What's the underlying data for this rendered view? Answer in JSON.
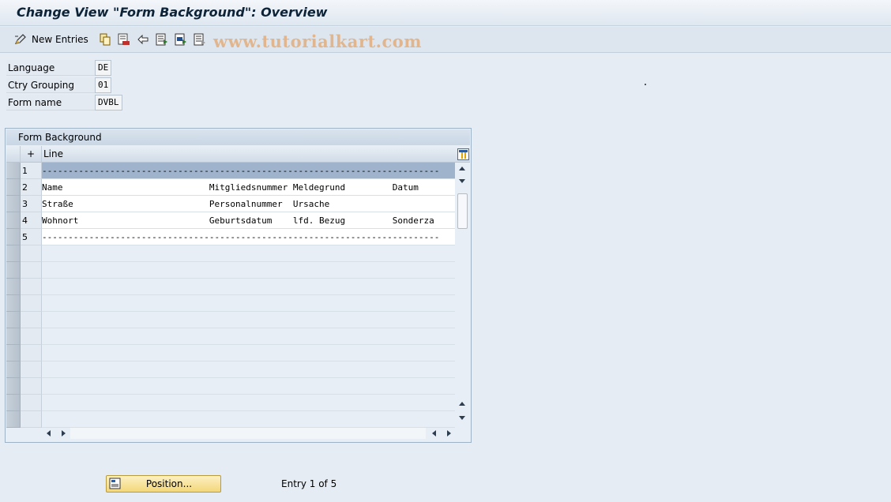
{
  "window": {
    "title": "Change View \"Form Background\": Overview"
  },
  "toolbar": {
    "new_entries_label": "New Entries",
    "watermark": "www.tutorialkart.com",
    "icons": [
      "edit-icon",
      "copy-icon",
      "delete-icon",
      "undo-icon",
      "select-all-icon",
      "select-block-icon",
      "deselect-all-icon"
    ]
  },
  "fields": {
    "language": {
      "label": "Language",
      "value": "DE"
    },
    "ctry_grouping": {
      "label": "Ctry Grouping",
      "value": "01"
    },
    "form_name": {
      "label": "Form name",
      "value": "DVBL"
    }
  },
  "table": {
    "title": "Form Background",
    "header_plus": "+",
    "column_header": "Line",
    "rows": [
      {
        "num": "1",
        "line": "----------------------------------------------------------------------------"
      },
      {
        "num": "2",
        "line": "Name                            Mitgliedsnummer Meldegrund         Datum"
      },
      {
        "num": "3",
        "line": "Straße                          Personalnummer  Ursache"
      },
      {
        "num": "4",
        "line": "Wohnort                         Geburtsdatum    lfd. Bezug         Sonderza"
      },
      {
        "num": "5",
        "line": "----------------------------------------------------------------------------"
      }
    ]
  },
  "footer": {
    "position_button": "Position...",
    "entry_info": "Entry 1 of 5"
  }
}
